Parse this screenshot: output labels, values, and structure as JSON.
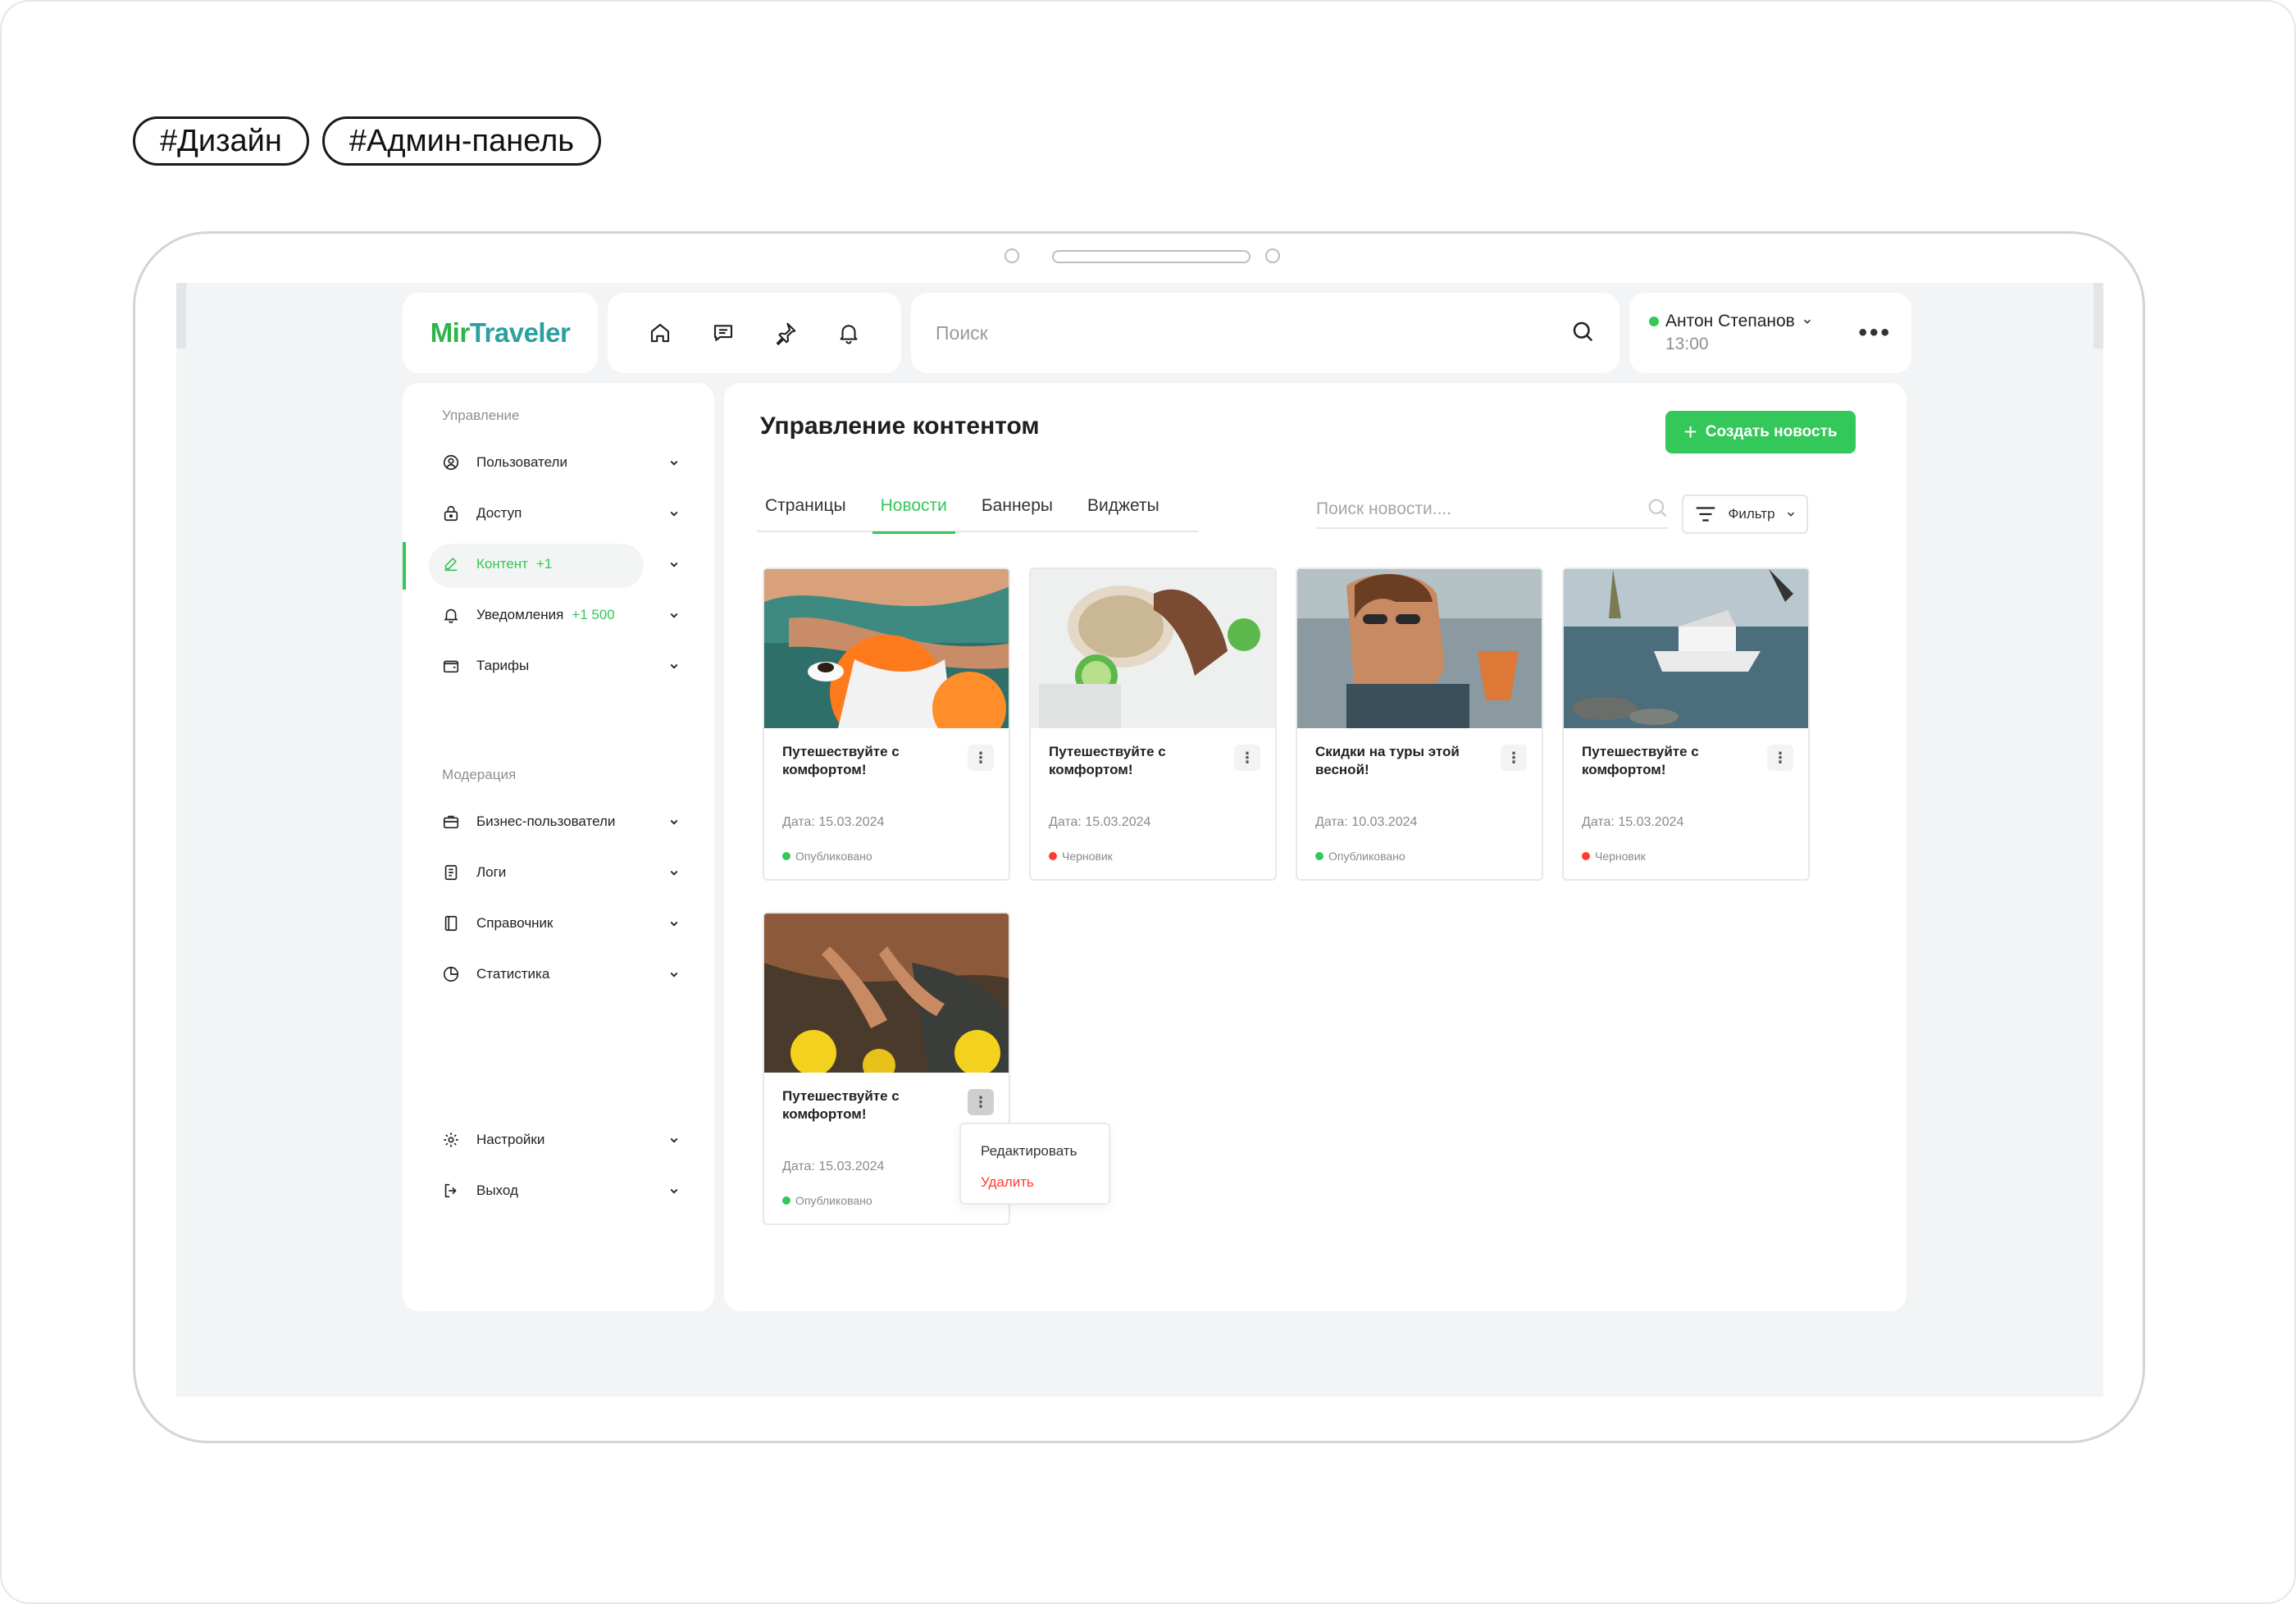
{
  "tags": [
    "#Дизайн",
    "#Админ-панель"
  ],
  "header": {
    "logo_part1": "Mir",
    "logo_part2": "Traveler",
    "search_placeholder": "Поиск",
    "user": {
      "name": "Антон Степанов",
      "time": "13:00",
      "status_color": "#34c759"
    },
    "nav_icons": [
      "home-icon",
      "chat-icon",
      "pin-icon",
      "bell-icon"
    ]
  },
  "sidebar": {
    "section1": "Управление",
    "items1": [
      {
        "label": "Пользователи",
        "icon": "user-icon"
      },
      {
        "label": "Доступ",
        "icon": "lock-icon"
      },
      {
        "label": "Контент",
        "badge": "+1",
        "icon": "edit-icon",
        "active": true
      },
      {
        "label": "Уведомления",
        "badge": "+1 500",
        "icon": "bell-icon"
      },
      {
        "label": "Тарифы",
        "icon": "wallet-icon"
      }
    ],
    "section2": "Модерация",
    "items2": [
      {
        "label": "Бизнес-пользователи",
        "icon": "briefcase-icon"
      },
      {
        "label": "Логи",
        "icon": "document-icon"
      },
      {
        "label": "Справочник",
        "icon": "book-icon"
      },
      {
        "label": "Статистика",
        "icon": "chart-icon"
      }
    ],
    "items3": [
      {
        "label": "Настройки",
        "icon": "gear-icon"
      },
      {
        "label": "Выход",
        "icon": "logout-icon"
      }
    ]
  },
  "main": {
    "title": "Управление контентом",
    "create_button": "Создать новость",
    "tabs": [
      "Страницы",
      "Новости",
      "Баннеры",
      "Виджеты"
    ],
    "active_tab": "Новости",
    "news_search_placeholder": "Поиск новости....",
    "filter_label": "Фильтр",
    "cards": [
      {
        "title": "Путешествуйте с комфортом!",
        "date": "Дата: 15.03.2024",
        "status": "Опубликовано",
        "status_color": "#34c759"
      },
      {
        "title": "Путешествуйте с комфортом!",
        "date": "Дата: 15.03.2024",
        "status": "Черновик",
        "status_color": "#ff3b30"
      },
      {
        "title": "Скидки на туры этой весной!",
        "date": "Дата: 10.03.2024",
        "status": "Опубликовано",
        "status_color": "#34c759"
      },
      {
        "title": "Путешествуйте с комфортом!",
        "date": "Дата: 15.03.2024",
        "status": "Черновик",
        "status_color": "#ff3b30"
      },
      {
        "title": "Путешествуйте с комфортом!",
        "date": "Дата: 15.03.2024",
        "status": "Опубликовано",
        "status_color": "#34c759"
      }
    ],
    "context_menu": {
      "edit": "Редактировать",
      "delete": "Удалить"
    }
  },
  "colors": {
    "accent": "#34c759",
    "danger": "#ff3b30",
    "background": "#f2f4f5"
  }
}
